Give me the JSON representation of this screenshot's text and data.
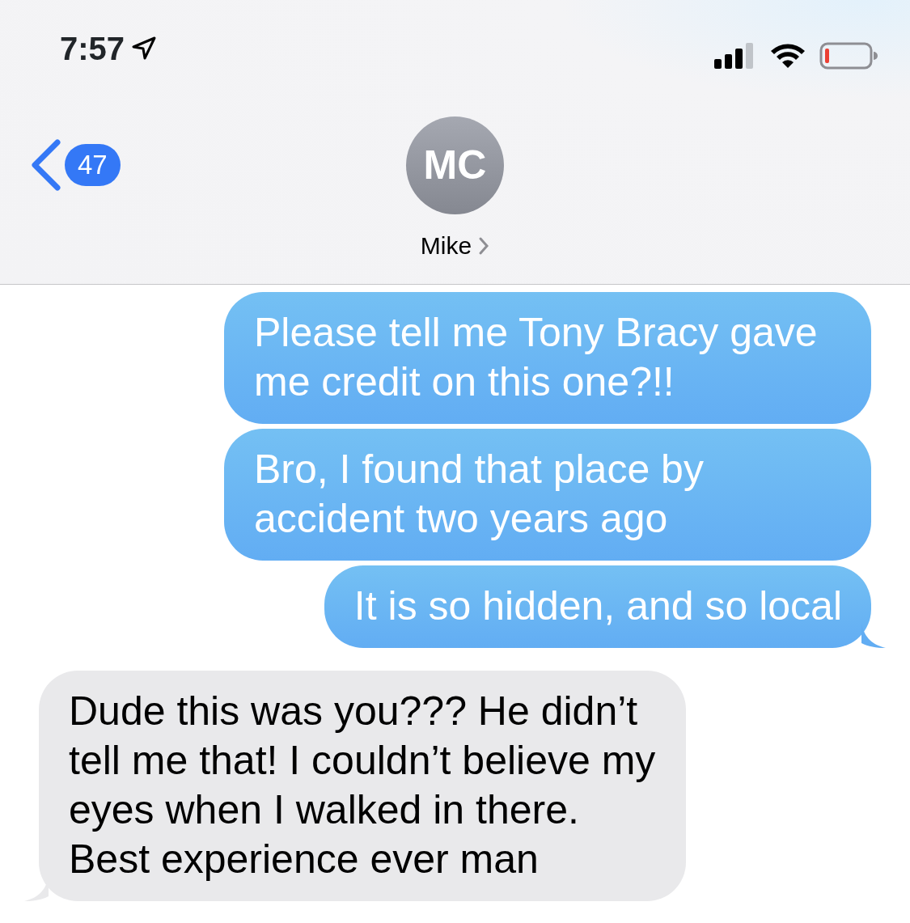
{
  "status_bar": {
    "time": "7:57"
  },
  "header": {
    "back_badge": "47",
    "avatar_initials": "MC",
    "contact_name": "Mike"
  },
  "messages": [
    {
      "kind": "sent",
      "text": "Please tell me Tony Bracy gave me credit on this one?!!",
      "tail": false
    },
    {
      "kind": "sent",
      "text": "Bro, I found that place by accident two years ago",
      "tail": false
    },
    {
      "kind": "sent",
      "text": "It is so hidden, and so local",
      "tail": true
    },
    {
      "kind": "received",
      "text": "Dude this was you??? He didn’t tell me that! I couldn’t believe my eyes when I walked in there. Best experience ever man",
      "tail": true
    }
  ]
}
